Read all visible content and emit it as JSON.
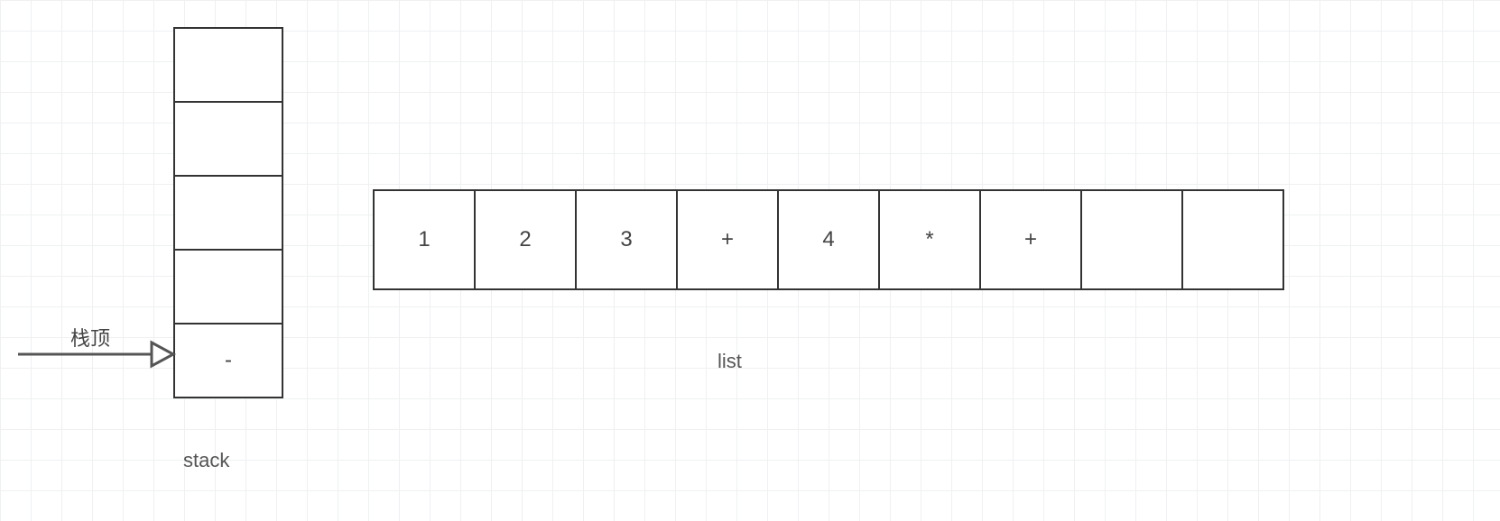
{
  "stack": {
    "label": "stack",
    "top_pointer_label": "栈顶",
    "cells": [
      "",
      "",
      "",
      "",
      "-"
    ]
  },
  "list": {
    "label": "list",
    "cells": [
      "1",
      "2",
      "3",
      "+",
      "4",
      "*",
      "+",
      "",
      ""
    ]
  }
}
